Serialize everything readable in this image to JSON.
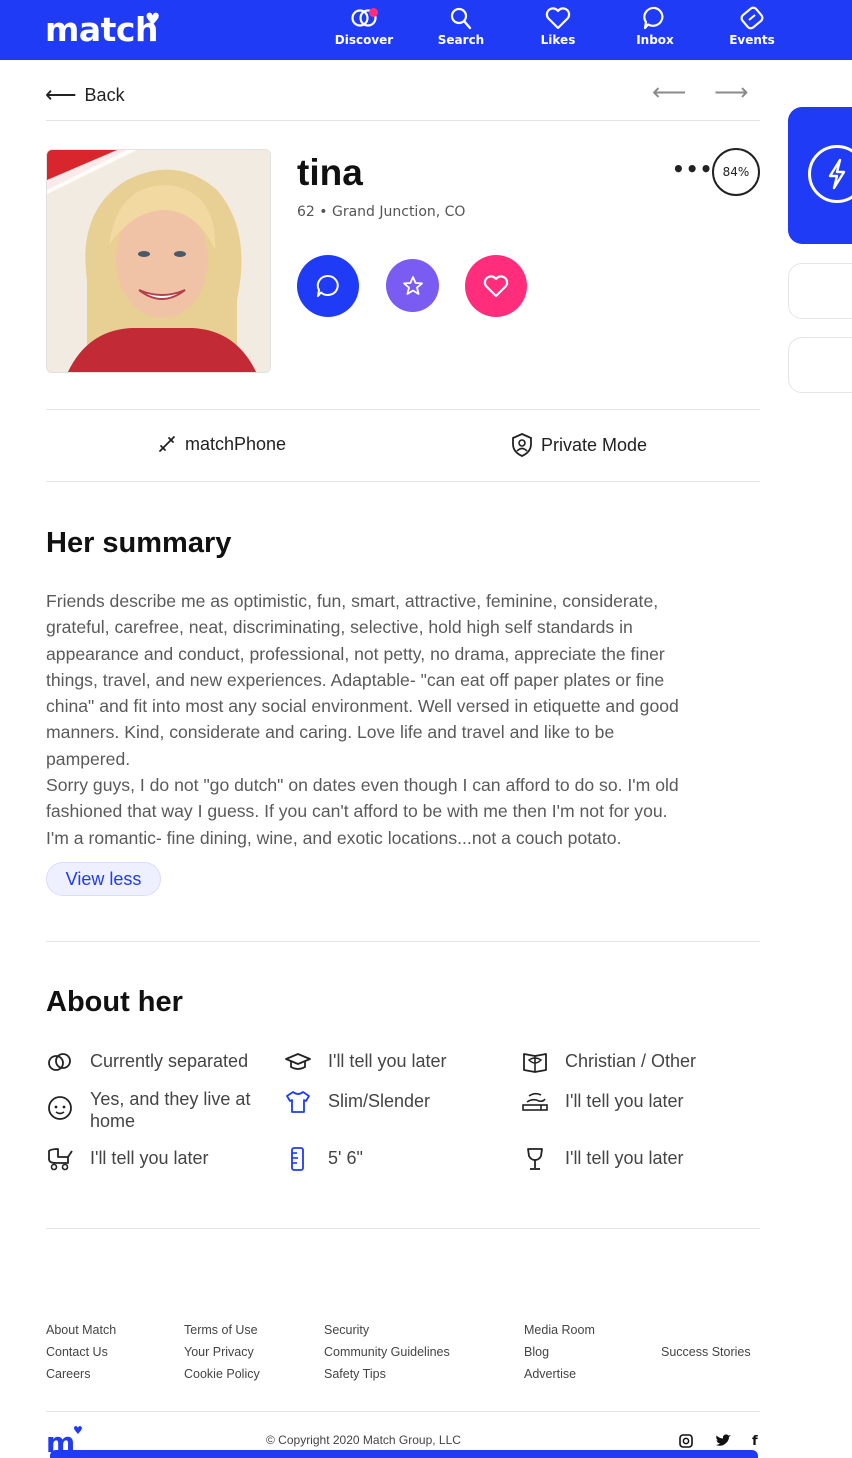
{
  "header": {
    "logo": "match",
    "nav": [
      {
        "label": "Discover",
        "icon": "discover-icon"
      },
      {
        "label": "Search",
        "icon": "search-icon"
      },
      {
        "label": "Likes",
        "icon": "heart-icon"
      },
      {
        "label": "Inbox",
        "icon": "chat-icon"
      },
      {
        "label": "Events",
        "icon": "ticket-icon"
      }
    ]
  },
  "top_nav": {
    "back_label": "Back"
  },
  "profile": {
    "name": "tina",
    "meta": "62 • Grand Junction, CO",
    "match_percent": "84%"
  },
  "features": {
    "match_phone": "matchPhone",
    "private_mode": "Private Mode"
  },
  "summary": {
    "heading": "Her summary",
    "text": "Friends describe me as optimistic, fun, smart, attractive, feminine, considerate,\ngrateful, carefree, neat, discriminating, selective, hold high self standards in\nappearance and conduct, professional, not petty, no drama, appreciate the finer\nthings, travel, and new experiences. Adaptable- \"can eat off paper plates or fine\nchina\" and fit into most any social environment. Well versed in etiquette and good\nmanners. Kind, considerate and caring. Love life and travel and like to be\npampered.\nSorry guys, I do not \"go dutch\" on dates even though I can afford to do so. I'm old\nfashioned that way I guess. If you can't afford to be with me then I'm not for you.\nI'm a romantic- fine dining, wine, and exotic locations...not a couch potato.",
    "view_less": "View less"
  },
  "about": {
    "heading": "About her",
    "items": [
      {
        "icon": "rings-icon",
        "text": "Currently separated"
      },
      {
        "icon": "graduation-cap-icon",
        "text": "I'll tell you later"
      },
      {
        "icon": "book-icon",
        "text": "Christian / Other"
      },
      {
        "icon": "child-face-icon",
        "text": "Yes, and they live at home"
      },
      {
        "icon": "shirt-icon",
        "text": "Slim/Slender"
      },
      {
        "icon": "cigarette-icon",
        "text": "I'll tell you later"
      },
      {
        "icon": "stroller-icon",
        "text": "I'll tell you later"
      },
      {
        "icon": "ruler-icon",
        "text": "5' 6\""
      },
      {
        "icon": "wine-glass-icon",
        "text": "I'll tell you later"
      }
    ]
  },
  "footer": {
    "col1": [
      "About Match",
      "Contact Us",
      "Careers"
    ],
    "col2": [
      "Terms of Use",
      "Your Privacy",
      "Cookie Policy"
    ],
    "col3": [
      "Security",
      "Community Guidelines",
      "Safety Tips"
    ],
    "col4": [
      "Media Room",
      "Blog",
      "Advertise"
    ],
    "col5": [
      "Success Stories"
    ],
    "copyright": "© Copyright 2020 Match Group, LLC",
    "logo": "m"
  },
  "colors": {
    "brand_blue": "#1f3bf5",
    "favorite_purple": "#7a5cf2",
    "like_pink": "#ff2d7c"
  }
}
